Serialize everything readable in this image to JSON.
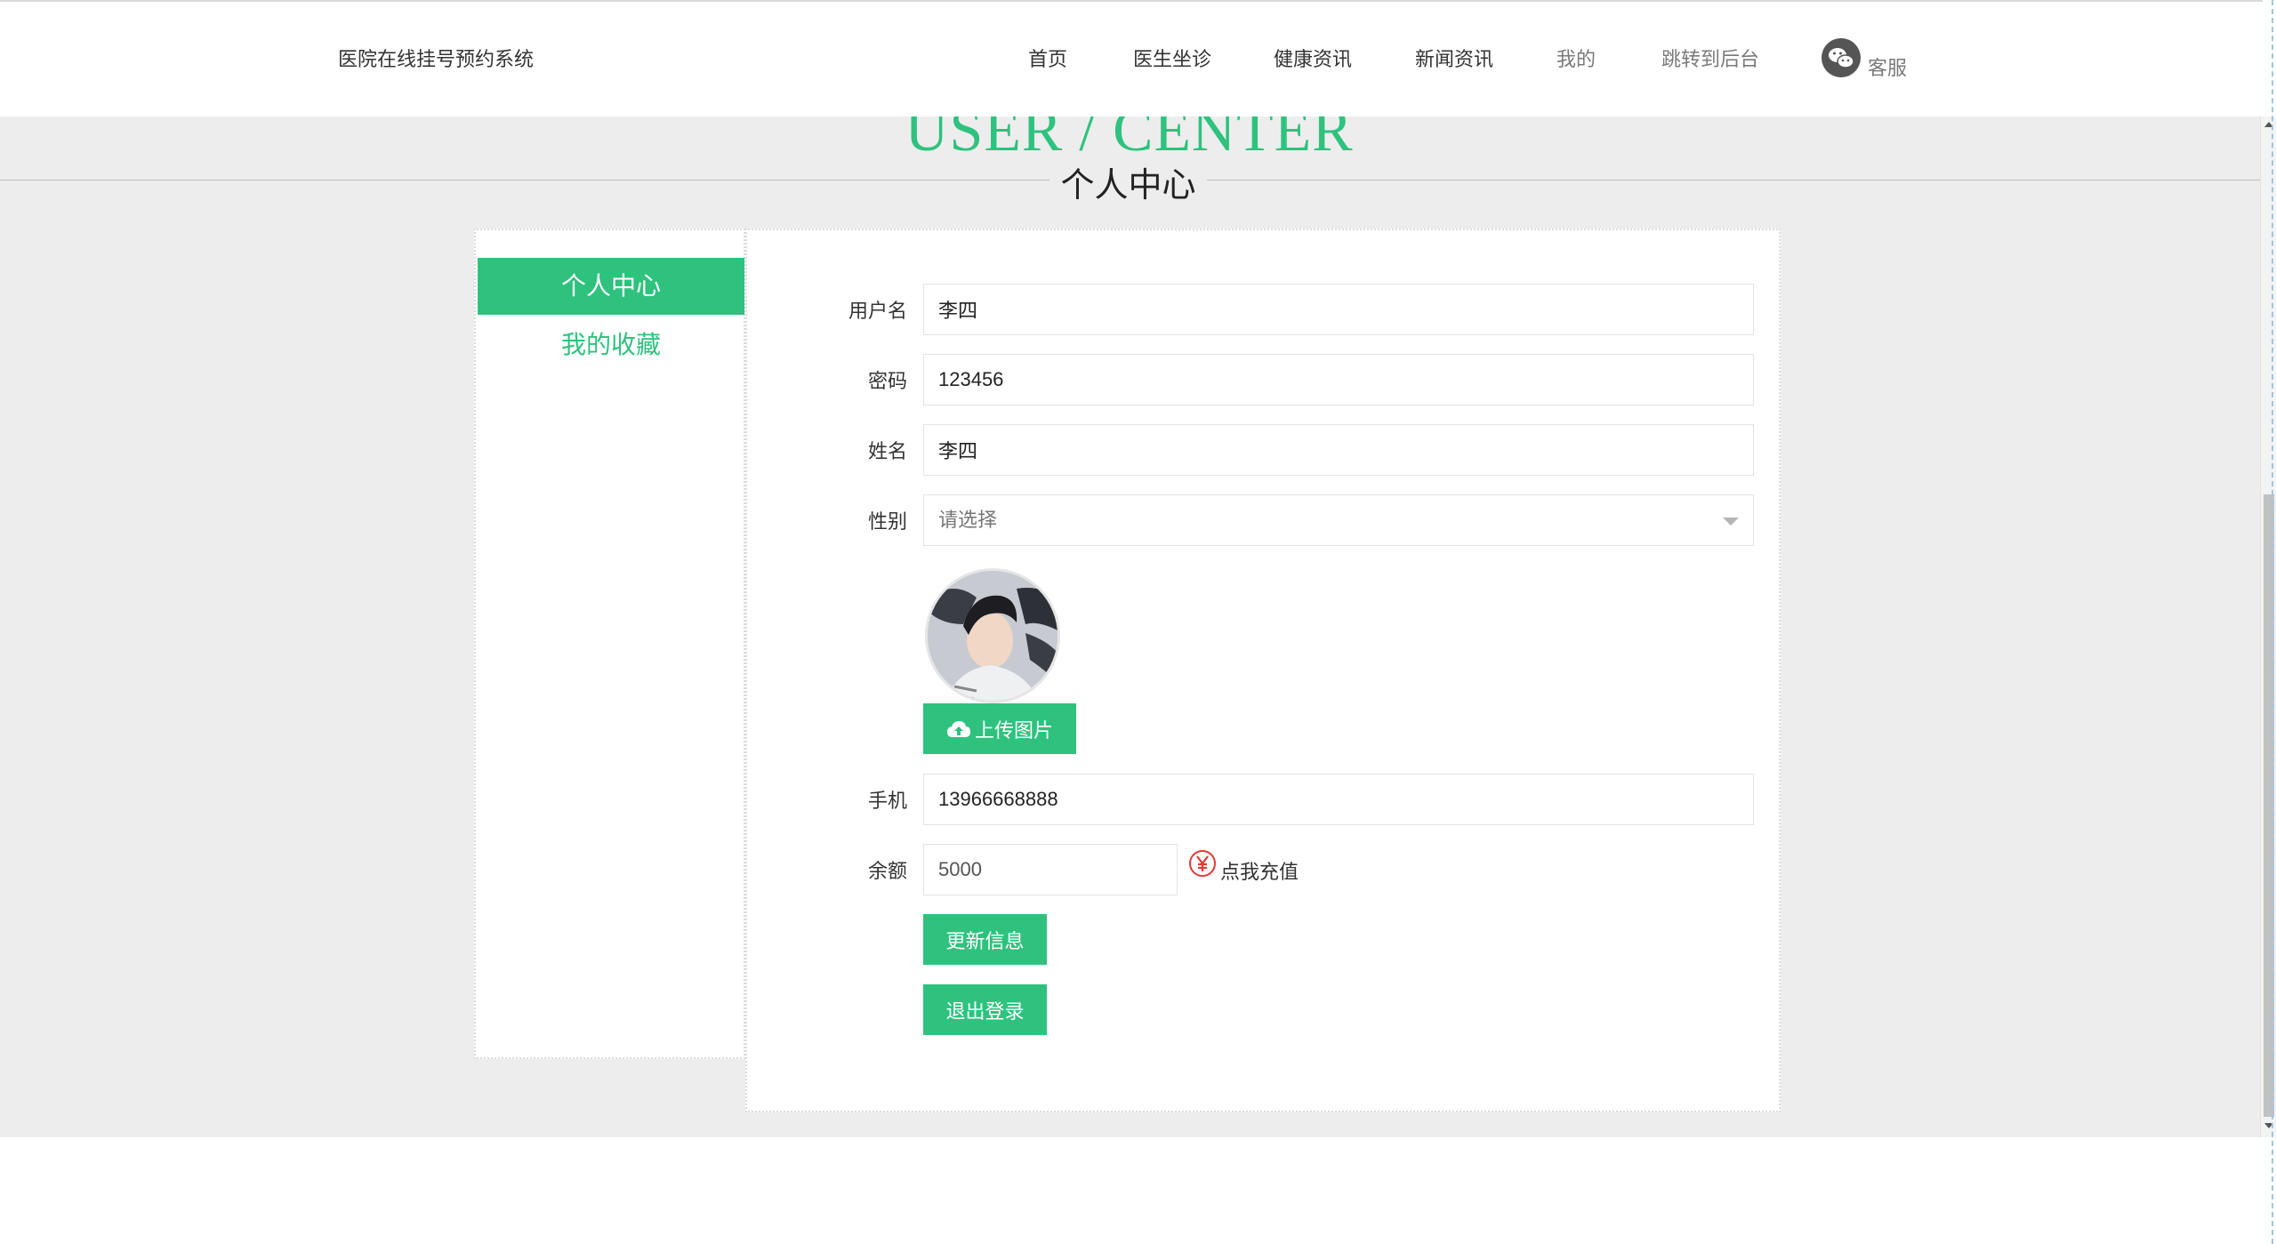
{
  "header": {
    "site_title": "医院在线挂号预约系统",
    "nav": [
      "首页",
      "医生坐诊",
      "健康资讯",
      "新闻资讯",
      "我的",
      "跳转到后台"
    ],
    "service_label": "客服",
    "service_icon": "wechat-icon"
  },
  "page": {
    "title_en": "USER / CENTER",
    "title_cn": "个人中心"
  },
  "sidebar": {
    "items": [
      {
        "label": "个人中心",
        "active": true
      },
      {
        "label": "我的收藏",
        "active": false
      }
    ]
  },
  "form": {
    "username_label": "用户名",
    "username_value": "李四",
    "password_label": "密码",
    "password_value": "123456",
    "name_label": "姓名",
    "name_value": "李四",
    "gender_label": "性别",
    "gender_placeholder": "请选择",
    "upload_label": "上传图片",
    "phone_label": "手机",
    "phone_value": "13966668888",
    "balance_label": "余额",
    "balance_value": "5000",
    "recharge_label": "点我充值",
    "update_label": "更新信息",
    "logout_label": "退出登录"
  },
  "colors": {
    "accent": "#2ec27e",
    "background": "#ededed",
    "recharge": "#e53935"
  }
}
